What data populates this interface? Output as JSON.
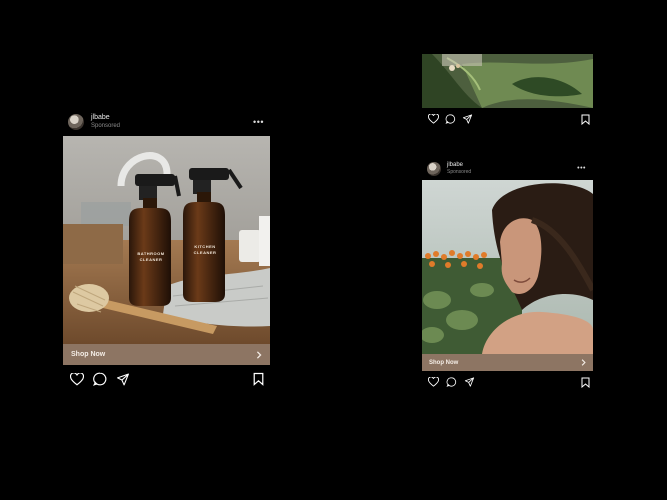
{
  "posts": [
    {
      "username": "jlbabe",
      "sponsored_label": "Sponsored",
      "more_label": "•••",
      "cta_label": "Shop Now",
      "image": "amber-spray-bottles",
      "bottle_labels": [
        "BATHROOM CLEANER",
        "KITCHEN CLEANER"
      ]
    },
    {
      "username": "jlbabe",
      "sponsored_label": "Sponsored",
      "more_label": "•••",
      "cta_label": "Shop Now",
      "image": "woman-in-greenhouse"
    }
  ],
  "partial_post": {
    "image": "green-leaves"
  },
  "icons": [
    "heart-icon",
    "comment-icon",
    "share-icon",
    "bookmark-icon",
    "chevron-right-icon"
  ],
  "colors": {
    "background": "#000000",
    "cta": "#8d7563",
    "cta_text": "#f4ede6"
  }
}
